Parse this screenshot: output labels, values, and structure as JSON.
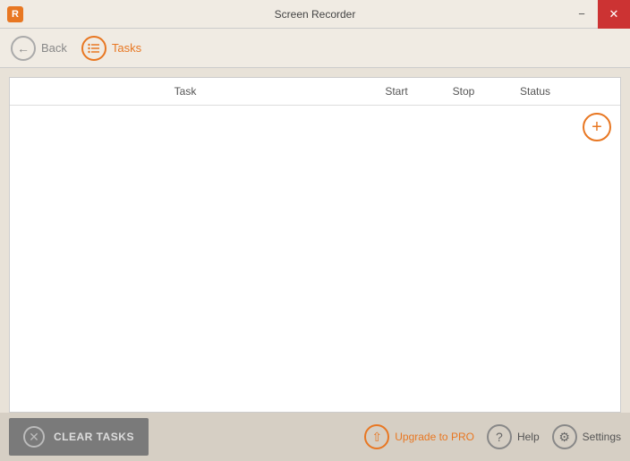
{
  "titlebar": {
    "app_icon_label": "R",
    "title": "Screen Recorder",
    "minimize_label": "−",
    "close_label": "✕"
  },
  "navbar": {
    "back_label": "Back",
    "tasks_label": "Tasks"
  },
  "table": {
    "columns": {
      "task": "Task",
      "start": "Start",
      "stop": "Stop",
      "status": "Status"
    },
    "rows": []
  },
  "toolbar": {
    "add_icon": "+",
    "clear_tasks_label": "CLEAR TASKS"
  },
  "bottom": {
    "upgrade_label": "Upgrade to PRO",
    "help_label": "Help",
    "settings_label": "Settings"
  }
}
